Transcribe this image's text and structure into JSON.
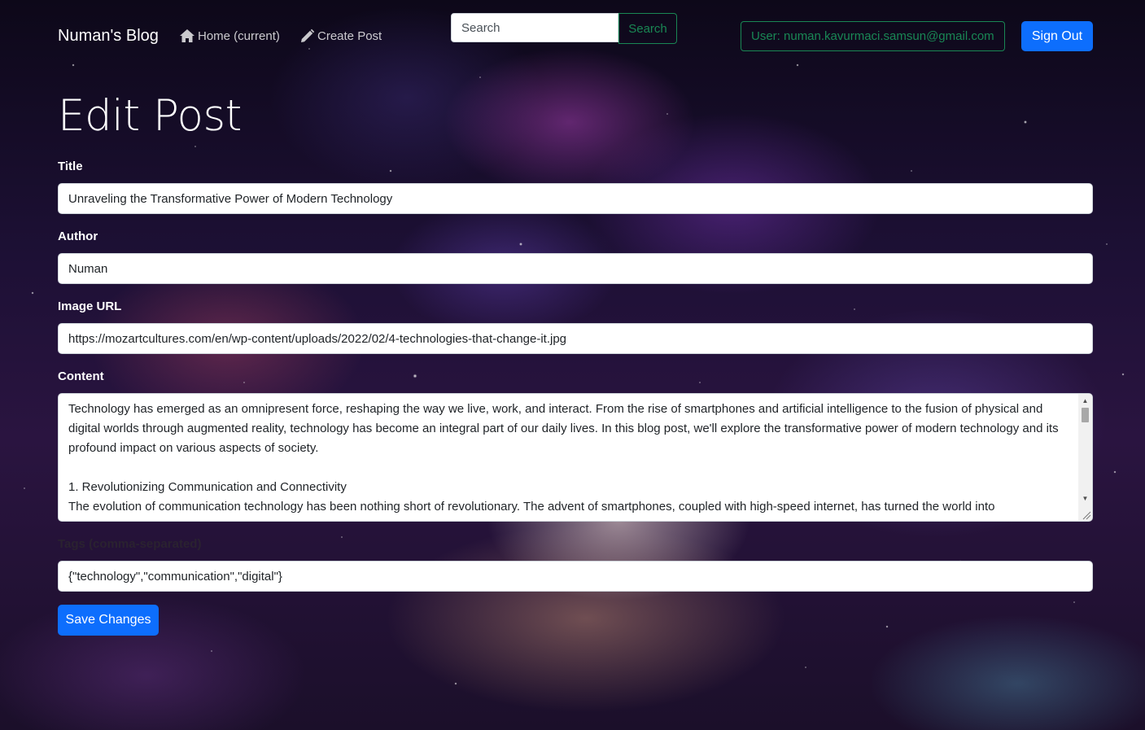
{
  "navbar": {
    "brand": "Numan's Blog",
    "home_label": "Home (current)",
    "create_label": "Create Post",
    "search_placeholder": "Search",
    "search_button": "Search",
    "user_label": "User: numan.kavurmaci.samsun@gmail.com",
    "signout_label": "Sign Out"
  },
  "form": {
    "heading": "Edit Post",
    "title_label": "Title",
    "title_value": "Unraveling the Transformative Power of Modern Technology",
    "author_label": "Author",
    "author_value": "Numan",
    "image_label": "Image URL",
    "image_value": "https://mozartcultures.com/en/wp-content/uploads/2022/02/4-technologies-that-change-it.jpg",
    "content_label": "Content",
    "content_value": "Technology has emerged as an omnipresent force, reshaping the way we live, work, and interact. From the rise of smartphones and artificial intelligence to the fusion of physical and digital worlds through augmented reality, technology has become an integral part of our daily lives. In this blog post, we'll explore the transformative power of modern technology and its profound impact on various aspects of society.\n\n1. Revolutionizing Communication and Connectivity\nThe evolution of communication technology has been nothing short of revolutionary. The advent of smartphones, coupled with high-speed internet, has turned the world into",
    "tags_label": "Tags (comma-separated)",
    "tags_value": "{\"technology\",\"communication\",\"digital\"}",
    "save_label": "Save Changes"
  },
  "icons": {
    "home": "home-icon",
    "create": "pencil-icon",
    "scroll_up": "scroll-up-arrow-icon",
    "scroll_down": "scroll-down-arrow-icon",
    "resize": "resize-grip-icon"
  },
  "colors": {
    "primary": "#0d6efd",
    "success": "#198754",
    "nav_link": "#c9c9d1"
  }
}
